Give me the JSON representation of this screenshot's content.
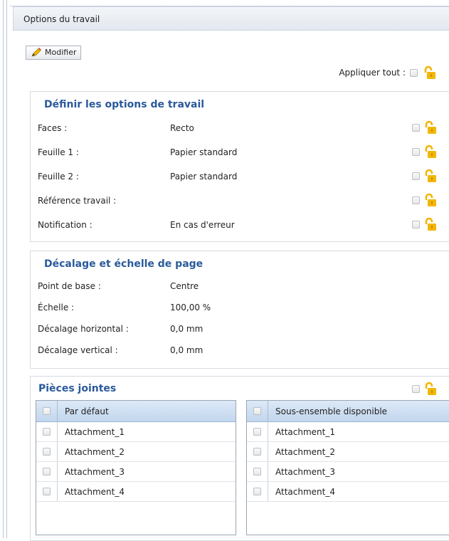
{
  "panel": {
    "title": "Options du travail"
  },
  "toolbar": {
    "edit_label": "Modifier",
    "apply_all_label": "Appliquer tout :"
  },
  "job_options": {
    "title": "Définir les options de travail",
    "rows": [
      {
        "label": "Faces :",
        "value": "Recto"
      },
      {
        "label": "Feuille 1 :",
        "value": "Papier standard"
      },
      {
        "label": "Feuille 2 :",
        "value": "Papier standard"
      },
      {
        "label": "Référence travail :",
        "value": ""
      },
      {
        "label": "Notification :",
        "value": "En cas d'erreur"
      }
    ]
  },
  "page_shift": {
    "title": "Décalage et échelle de page",
    "rows": [
      {
        "label": "Point de base :",
        "value": "Centre"
      },
      {
        "label": "Échelle :",
        "value": "100,00 %"
      },
      {
        "label": "Décalage horizontal :",
        "value": "0,0 mm"
      },
      {
        "label": "Décalage vertical :",
        "value": "0,0 mm"
      }
    ]
  },
  "attachments": {
    "title": "Pièces jointes",
    "default_list": {
      "header": "Par défaut",
      "items": [
        "Attachment_1",
        "Attachment_2",
        "Attachment_3",
        "Attachment_4"
      ]
    },
    "subset_list": {
      "header": "Sous-ensemble disponible",
      "items": [
        "Attachment_1",
        "Attachment_2",
        "Attachment_3",
        "Attachment_4"
      ]
    }
  },
  "icons": {
    "edit": "pencil-icon",
    "lock": "unlocked-padlock-icon"
  },
  "colors": {
    "section_title": "#2a5a9a",
    "lock": "#f2b705",
    "list_header": "#c2d6ee"
  }
}
